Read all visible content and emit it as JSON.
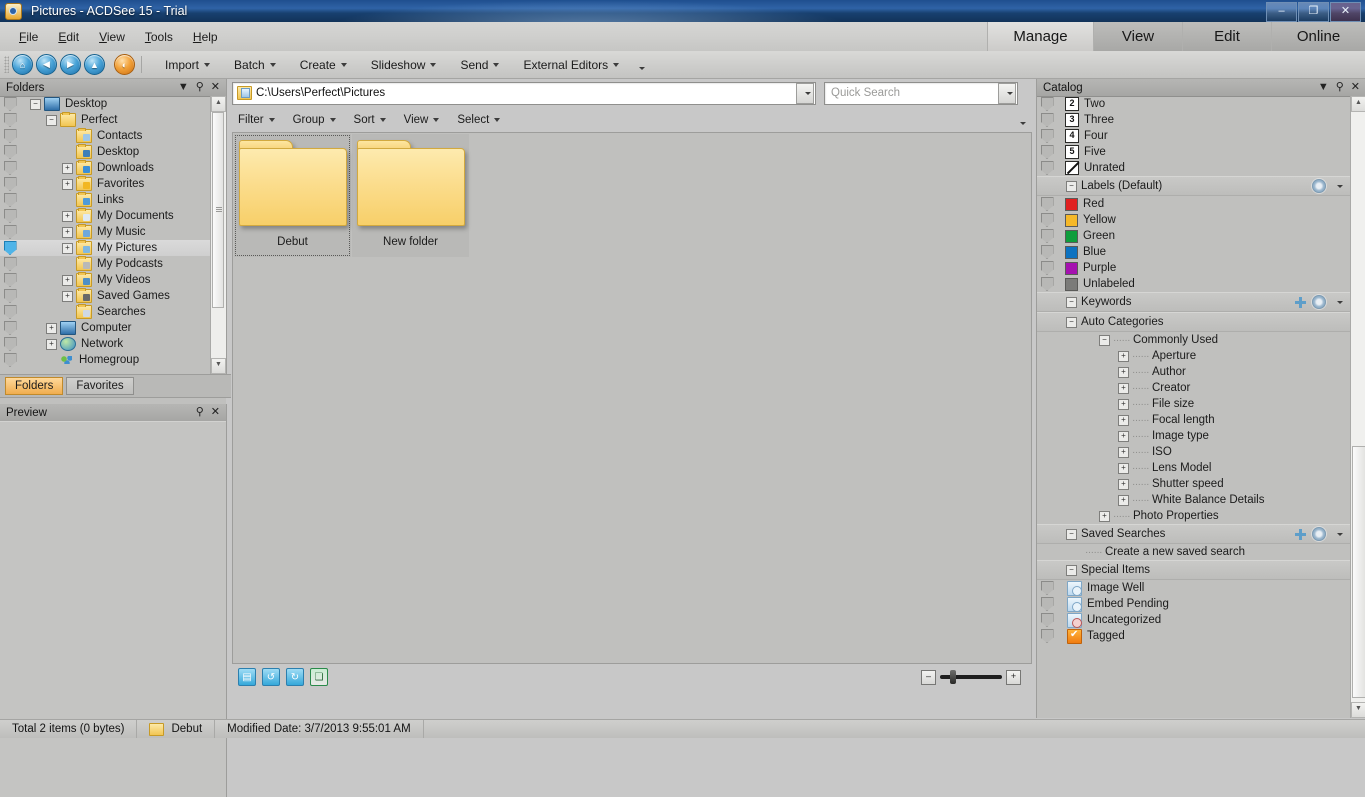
{
  "window": {
    "title": "Pictures - ACDSee 15 - Trial",
    "minimize": "–",
    "maximize": "❐",
    "close": "✕"
  },
  "menu": [
    "File",
    "Edit",
    "View",
    "Tools",
    "Help"
  ],
  "mode_tabs": [
    {
      "label": "Manage",
      "active": true
    },
    {
      "label": "View",
      "active": false
    },
    {
      "label": "Edit",
      "active": false
    },
    {
      "label": "Online",
      "active": false
    }
  ],
  "toolbar": {
    "nav": [
      "home-icon",
      "back-icon",
      "forward-icon",
      "up-icon",
      "acdsee-icon"
    ],
    "items": [
      "Import",
      "Batch",
      "Create",
      "Slideshow",
      "Send",
      "External Editors"
    ],
    "overflow": "more-toolbar-chevron"
  },
  "folders_panel": {
    "title": "Folders",
    "tree": [
      {
        "label": "Desktop",
        "indent": 0,
        "expander": "minus",
        "icon": "monitor-icon",
        "tagged": false,
        "selected": false
      },
      {
        "label": "Perfect",
        "indent": 1,
        "expander": "minus",
        "icon": "user-folder-icon",
        "tagged": false,
        "selected": false
      },
      {
        "label": "Contacts",
        "indent": 2,
        "expander": "none",
        "icon": "contacts-folder-icon",
        "tagged": false,
        "selected": false
      },
      {
        "label": "Desktop",
        "indent": 2,
        "expander": "none",
        "icon": "desktop-folder-icon",
        "tagged": false,
        "selected": false
      },
      {
        "label": "Downloads",
        "indent": 2,
        "expander": "plus",
        "icon": "downloads-folder-icon",
        "tagged": false,
        "selected": false
      },
      {
        "label": "Favorites",
        "indent": 2,
        "expander": "plus",
        "icon": "favorites-folder-icon",
        "tagged": false,
        "selected": false
      },
      {
        "label": "Links",
        "indent": 2,
        "expander": "none",
        "icon": "links-folder-icon",
        "tagged": false,
        "selected": false
      },
      {
        "label": "My Documents",
        "indent": 2,
        "expander": "plus",
        "icon": "documents-folder-icon",
        "tagged": false,
        "selected": false
      },
      {
        "label": "My Music",
        "indent": 2,
        "expander": "plus",
        "icon": "music-folder-icon",
        "tagged": false,
        "selected": false
      },
      {
        "label": "My Pictures",
        "indent": 2,
        "expander": "plus",
        "icon": "pictures-folder-icon",
        "tagged": true,
        "selected": true
      },
      {
        "label": "My Podcasts",
        "indent": 2,
        "expander": "none",
        "icon": "podcasts-folder-icon",
        "tagged": false,
        "selected": false
      },
      {
        "label": "My Videos",
        "indent": 2,
        "expander": "plus",
        "icon": "videos-folder-icon",
        "tagged": false,
        "selected": false
      },
      {
        "label": "Saved Games",
        "indent": 2,
        "expander": "plus",
        "icon": "games-folder-icon",
        "tagged": false,
        "selected": false
      },
      {
        "label": "Searches",
        "indent": 2,
        "expander": "none",
        "icon": "searches-folder-icon",
        "tagged": false,
        "selected": false
      },
      {
        "label": "Computer",
        "indent": 1,
        "expander": "plus",
        "icon": "computer-icon",
        "tagged": false,
        "selected": false
      },
      {
        "label": "Network",
        "indent": 1,
        "expander": "plus",
        "icon": "network-icon",
        "tagged": false,
        "selected": false
      },
      {
        "label": "Homegroup",
        "indent": 1,
        "expander": "none",
        "icon": "homegroup-icon",
        "tagged": false,
        "selected": false
      }
    ],
    "tabs": [
      {
        "label": "Folders",
        "active": true
      },
      {
        "label": "Favorites",
        "active": false
      }
    ]
  },
  "preview_panel": {
    "title": "Preview"
  },
  "address": {
    "path": "C:\\Users\\Perfect\\Pictures",
    "dropdown": "address-dropdown"
  },
  "search": {
    "placeholder": "Quick Search",
    "value": ""
  },
  "filterbar": [
    "Filter",
    "Group",
    "Sort",
    "View",
    "Select"
  ],
  "content": {
    "items": [
      {
        "name": "Debut",
        "type": "folder",
        "selected": true
      },
      {
        "name": "New folder",
        "type": "folder",
        "selected": false
      }
    ]
  },
  "bottom_toolbar": {
    "icons": [
      "thumbnail-view-icon",
      "rotate-left-icon",
      "rotate-right-icon",
      "filmstrip-icon"
    ],
    "zoom_out": "–",
    "zoom_in": "+"
  },
  "catalog": {
    "title": "Catalog",
    "ratings": [
      {
        "label": "Two",
        "value": "2"
      },
      {
        "label": "Three",
        "value": "3"
      },
      {
        "label": "Four",
        "value": "4"
      },
      {
        "label": "Five",
        "value": "5"
      },
      {
        "label": "Unrated",
        "value": ""
      }
    ],
    "labels_section": "Labels (Default)",
    "labels": [
      {
        "label": "Red",
        "color": "#e02020"
      },
      {
        "label": "Yellow",
        "color": "#f5b828"
      },
      {
        "label": "Green",
        "color": "#0f9d3c"
      },
      {
        "label": "Blue",
        "color": "#0d72c0"
      },
      {
        "label": "Purple",
        "color": "#a511b0"
      },
      {
        "label": "Unlabeled",
        "color": "#7b7b79"
      }
    ],
    "keywords_section": "Keywords",
    "auto_categories_section": "Auto Categories",
    "commonly_used": "Commonly Used",
    "commonly_used_items": [
      "Aperture",
      "Author",
      "Creator",
      "File size",
      "Focal length",
      "Image type",
      "ISO",
      "Lens Model",
      "Shutter speed",
      "White Balance Details"
    ],
    "photo_properties": "Photo Properties",
    "saved_searches_section": "Saved Searches",
    "saved_search_item": "Create a new saved search",
    "special_items_section": "Special Items",
    "special_items": [
      {
        "label": "Image Well",
        "icon": "image-well-icon"
      },
      {
        "label": "Embed Pending",
        "icon": "embed-pending-icon"
      },
      {
        "label": "Uncategorized",
        "icon": "uncategorized-icon"
      },
      {
        "label": "Tagged",
        "icon": "tagged-icon"
      }
    ]
  },
  "statusbar": {
    "total": "Total 2 items  (0 bytes)",
    "selected_name": "Debut",
    "modified": "Modified Date: 3/7/2013 9:55:01 AM"
  },
  "colors": {
    "titlebar": "#2f63a6",
    "chrome": "#c0c0be",
    "accent_orange": "#f0ad4f",
    "selection": "#d6d6d4"
  }
}
